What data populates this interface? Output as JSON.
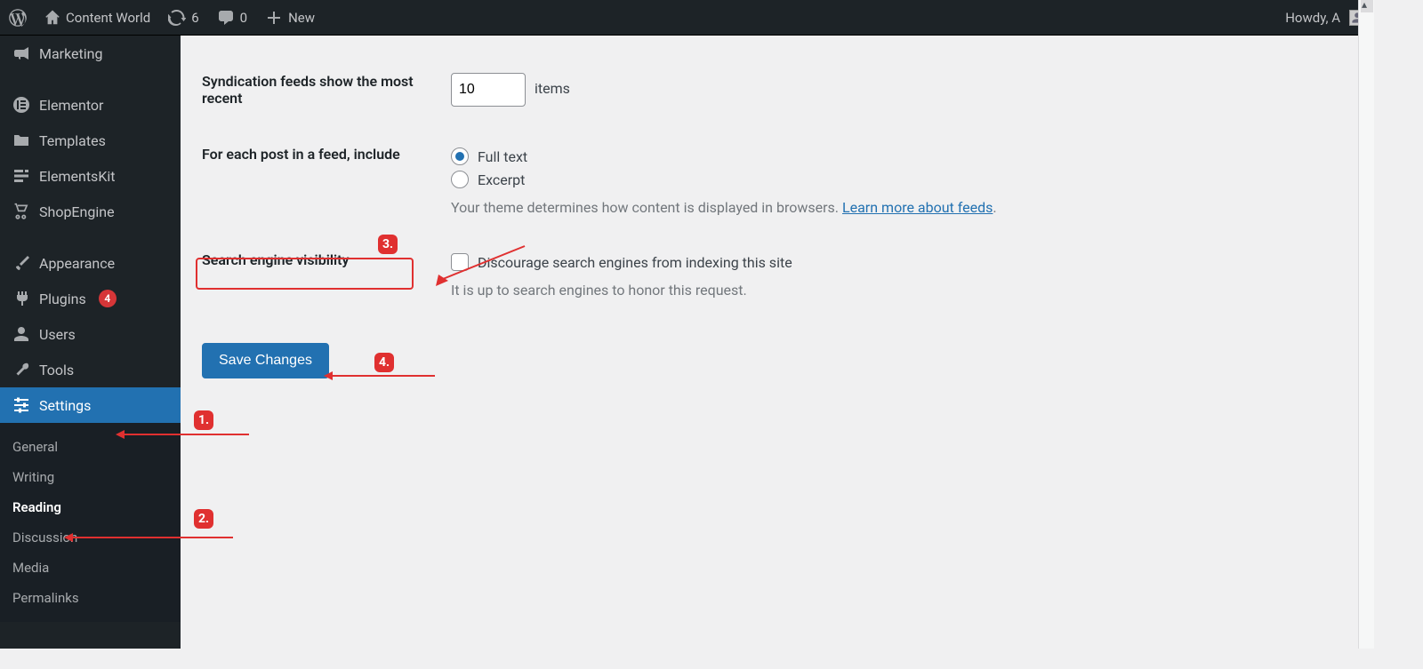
{
  "adminbar": {
    "site_name": "Content World",
    "updates_count": "6",
    "comments_count": "0",
    "new_label": "New",
    "howdy": "Howdy, A"
  },
  "sidebar": {
    "items": [
      {
        "id": "marketing",
        "label": "Marketing"
      },
      {
        "id": "elementor",
        "label": "Elementor"
      },
      {
        "id": "templates",
        "label": "Templates"
      },
      {
        "id": "elementskit",
        "label": "ElementsKit"
      },
      {
        "id": "shopengine",
        "label": "ShopEngine"
      },
      {
        "id": "appearance",
        "label": "Appearance"
      },
      {
        "id": "plugins",
        "label": "Plugins",
        "badge": "4"
      },
      {
        "id": "users",
        "label": "Users"
      },
      {
        "id": "tools",
        "label": "Tools"
      },
      {
        "id": "settings",
        "label": "Settings",
        "current": true
      }
    ],
    "submenu": [
      {
        "id": "general",
        "label": "General"
      },
      {
        "id": "writing",
        "label": "Writing"
      },
      {
        "id": "reading",
        "label": "Reading",
        "current": true
      },
      {
        "id": "discussion",
        "label": "Discussion"
      },
      {
        "id": "media",
        "label": "Media"
      },
      {
        "id": "permalinks",
        "label": "Permalinks"
      }
    ]
  },
  "settings": {
    "feed_count_label": "Syndication feeds show the most recent",
    "feed_count_value": "10",
    "feed_items_suffix": "items",
    "feed_include_label": "For each post in a feed, include",
    "feed_full": "Full text",
    "feed_excerpt": "Excerpt",
    "feed_desc_prefix": "Your theme determines how content is displayed in browsers. ",
    "feed_desc_link": "Learn more about feeds",
    "visibility_label": "Search engine visibility",
    "visibility_checkbox": "Discourage search engines from indexing this site",
    "visibility_note": "It is up to search engines to honor this request.",
    "save_btn": "Save Changes"
  },
  "steps": {
    "s1": "1",
    "s2": "2",
    "s3": "3",
    "s4": "4"
  }
}
